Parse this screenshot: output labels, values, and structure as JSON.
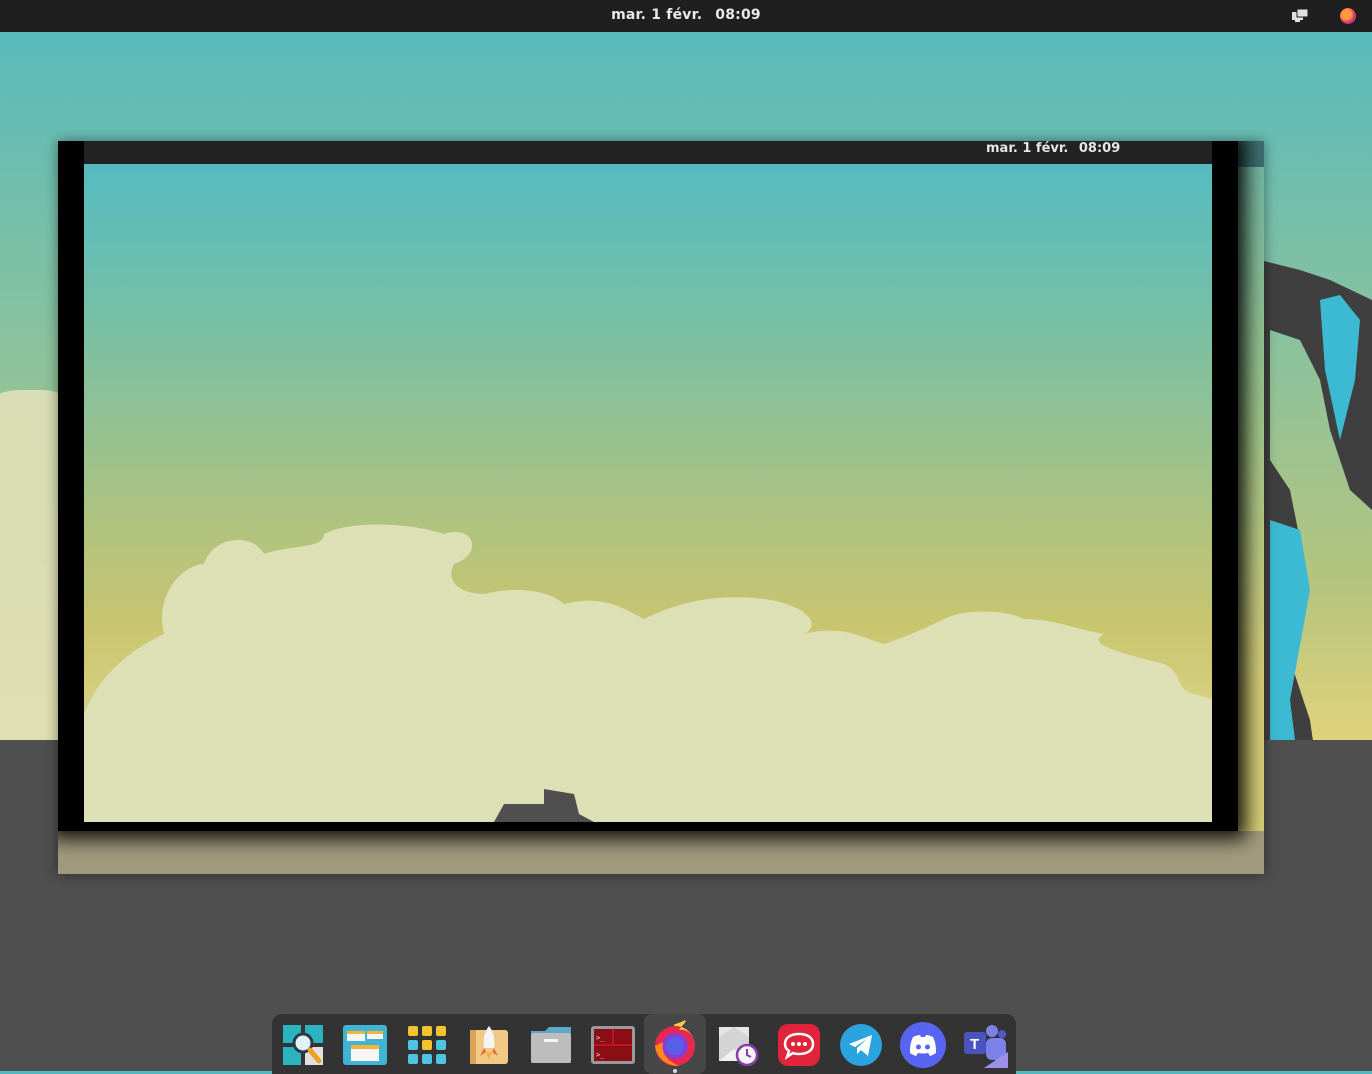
{
  "topbar": {
    "date": "mar. 1 févr.",
    "time": "08:09",
    "tray_icons": [
      "display-icon",
      "firefox-tray-icon"
    ]
  },
  "workspace_preview": {
    "date": "mar. 1 févr.",
    "time": "08:09"
  },
  "dock": {
    "items": [
      {
        "name": "search-app-icon",
        "active": false
      },
      {
        "name": "workspaces-icon",
        "active": false
      },
      {
        "name": "app-grid-icon",
        "active": false
      },
      {
        "name": "launcher-rocket-icon",
        "active": false
      },
      {
        "name": "files-icon",
        "active": false
      },
      {
        "name": "terminal-icon",
        "active": false
      },
      {
        "name": "firefox-icon",
        "active": true
      },
      {
        "name": "mail-clock-icon",
        "active": false
      },
      {
        "name": "rocketchat-icon",
        "active": false
      },
      {
        "name": "telegram-icon",
        "active": false
      },
      {
        "name": "discord-icon",
        "active": false
      },
      {
        "name": "teams-icon",
        "active": false
      }
    ]
  },
  "colors": {
    "topbar": "#1f1f1f",
    "dock": "#333333",
    "ground": "#4f4f4f",
    "sky_top": "#53b9bf",
    "sky_bottom": "#e8d98c"
  }
}
